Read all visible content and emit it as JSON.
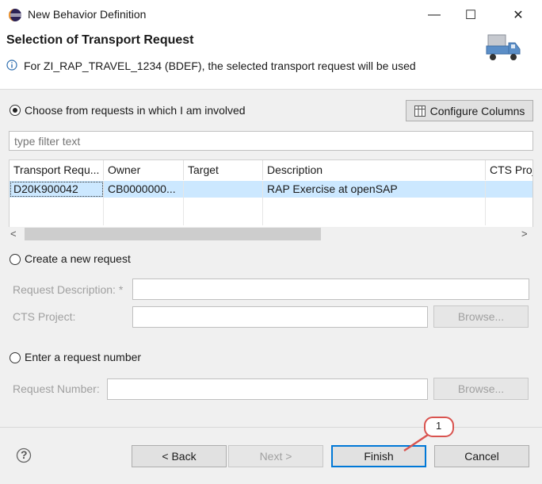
{
  "window": {
    "title": "New Behavior Definition",
    "minimize_glyph": "—",
    "maximize_glyph": "☐",
    "close_glyph": "✕"
  },
  "header": {
    "title": "Selection of Transport Request",
    "message": "For ZI_RAP_TRAVEL_1234 (BDEF), the selected transport request will be used",
    "info_icon": "info-icon",
    "banner_icon": "truck-icon"
  },
  "option_involved": {
    "label": "Choose from requests in which I am involved",
    "selected": true
  },
  "configure_columns": {
    "label": "Configure Columns"
  },
  "filter": {
    "placeholder": "type filter text"
  },
  "table": {
    "columns": [
      "Transport Requ...",
      "Owner",
      "Target",
      "Description",
      "CTS Proj"
    ],
    "rows": [
      [
        "D20K900042",
        "CB0000000...",
        "",
        "RAP Exercise at openSAP",
        ""
      ]
    ]
  },
  "scroll": {
    "left": "<",
    "right": ">"
  },
  "option_new": {
    "label": "Create a new request",
    "desc_label": "Request Description: *",
    "cts_label": "CTS Project:",
    "browse_label": "Browse..."
  },
  "option_number": {
    "label": "Enter a request number",
    "number_label": "Request Number:",
    "browse_label": "Browse..."
  },
  "footer": {
    "help_glyph": "?",
    "back_label": "< Back",
    "next_label": "Next >",
    "finish_label": "Finish",
    "cancel_label": "Cancel"
  },
  "callout": {
    "number": "1"
  },
  "colors": {
    "selection": "#cce8ff",
    "default_button_border": "#0078d7",
    "callout_red": "#d9534f",
    "info_blue": "#2f6fb0"
  }
}
